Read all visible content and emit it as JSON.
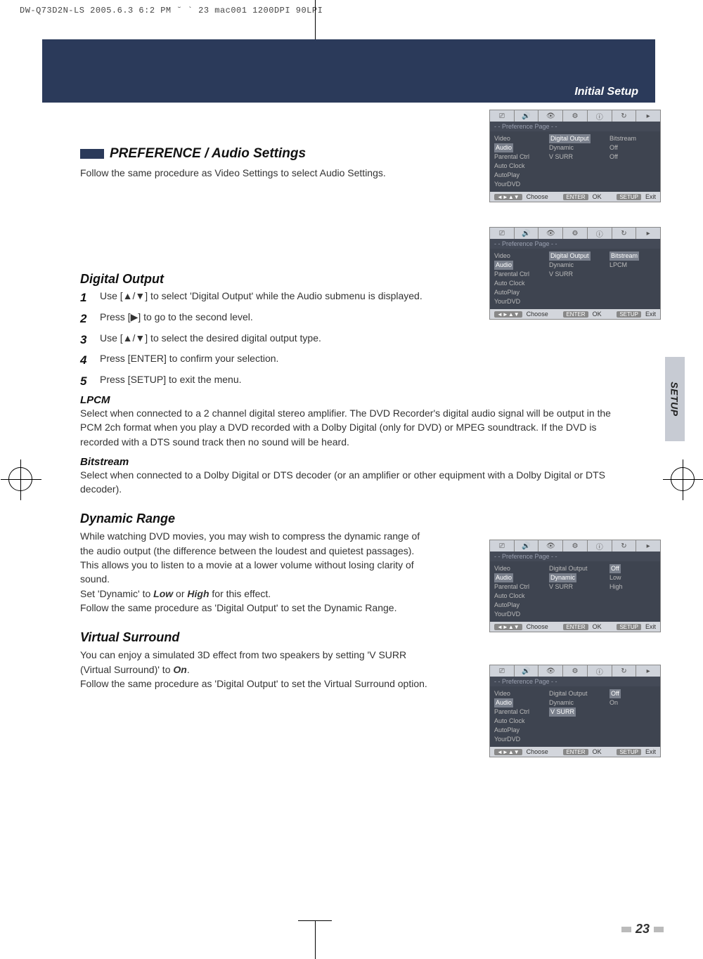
{
  "print_header": "DW-Q73D2N-LS  2005.6.3 6:2 PM  ˘   ` 23   mac001   1200DPI 90LPI",
  "header_title": "Initial Setup",
  "section_title": "PREFERENCE / Audio Settings",
  "intro": "Follow the same procedure as Video Settings to select Audio Settings.",
  "side_tab": "SETUP",
  "page_number": "23",
  "digital_output": {
    "heading": "Digital Output",
    "steps": [
      "Use [▲/▼] to select 'Digital Output' while the Audio submenu is displayed.",
      "Press [▶] to go to the second level.",
      "Use [▲/▼] to select the desired digital output type.",
      "Press [ENTER] to confirm your selection.",
      "Press [SETUP] to exit the menu."
    ],
    "lpcm_heading": "LPCM",
    "lpcm_text": "Select when connected to a 2 channel digital stereo amplifier. The DVD Recorder's digital audio signal will be output in the PCM 2ch format when you play a DVD recorded with a Dolby Digital (only for DVD) or MPEG soundtrack. If the DVD is recorded with a DTS sound track then no sound will be heard.",
    "bitstream_heading": "Bitstream",
    "bitstream_text": "Select when connected to a Dolby Digital or DTS decoder (or an amplifier or other equipment with a Dolby Digital or DTS decoder)."
  },
  "dynamic_range": {
    "heading": "Dynamic Range",
    "text": "While watching DVD movies, you may wish to compress the dynamic range of the audio output (the difference between the loudest and quietest passages). This allows you to listen to a movie at a lower volume without losing clarity of sound.",
    "set_prefix": "Set 'Dynamic' to ",
    "low": "Low",
    "or": " or ",
    "high": "High",
    "set_suffix": " for this effect.",
    "follow": "Follow the same procedure as 'Digital Output' to set the Dynamic Range."
  },
  "virtual_surround": {
    "heading": "Virtual Surround",
    "text1_prefix": "You can enjoy a simulated 3D effect from two speakers by setting 'V SURR (Virtual Surround)' to ",
    "on": "On",
    "text1_suffix": ".",
    "follow": "Follow the same procedure as 'Digital Output' to set the Virtual Surround option."
  },
  "osd_common": {
    "pref_page": "- - Preference Page - -",
    "choose": "Choose",
    "ok": "OK",
    "exit": "Exit",
    "enter_btn": "ENTER",
    "setup_btn": "SETUP",
    "nav_btn": "◄►▲▼"
  },
  "osd1": {
    "c1": [
      "Video",
      "Audio",
      "Parental Ctrl",
      "Auto Clock",
      "AutoPlay",
      "YourDVD"
    ],
    "c2": [
      "Digital Output",
      "Dynamic",
      "V SURR"
    ],
    "c3": [
      "Bitstream",
      "Off",
      "Off"
    ]
  },
  "osd2": {
    "c1": [
      "Video",
      "Audio",
      "Parental Ctrl",
      "Auto Clock",
      "AutoPlay",
      "YourDVD"
    ],
    "c2": [
      "Digital Output",
      "Dynamic",
      "V SURR"
    ],
    "c3": [
      "Bitstream",
      "LPCM"
    ]
  },
  "osd3": {
    "c1": [
      "Video",
      "Audio",
      "Parental Ctrl",
      "Auto Clock",
      "AutoPlay",
      "YourDVD"
    ],
    "c2": [
      "Digital Output",
      "Dynamic",
      "V SURR"
    ],
    "c3": [
      "Off",
      "Low",
      "High"
    ]
  },
  "osd4": {
    "c1": [
      "Video",
      "Audio",
      "Parental Ctrl",
      "Auto Clock",
      "AutoPlay",
      "YourDVD"
    ],
    "c2": [
      "Digital Output",
      "Dynamic",
      "V SURR"
    ],
    "c3": [
      "Off",
      "On"
    ]
  }
}
